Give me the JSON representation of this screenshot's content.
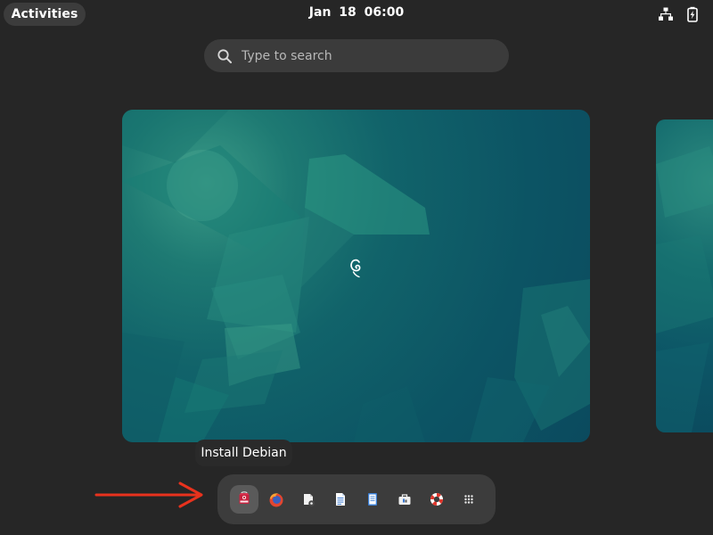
{
  "topbar": {
    "activities_label": "Activities",
    "clock": "Jan 18  06:00"
  },
  "search": {
    "placeholder": "Type to search"
  },
  "tooltip": {
    "label": "Install Debian"
  },
  "dash": {
    "apps": [
      {
        "name": "install-debian",
        "icon": "installer-icon",
        "active": true
      },
      {
        "name": "firefox",
        "icon": "firefox-icon"
      },
      {
        "name": "software",
        "icon": "software-icon"
      },
      {
        "name": "text-editor",
        "icon": "document-icon"
      },
      {
        "name": "text-editor-alt",
        "icon": "notes-icon"
      },
      {
        "name": "settings-tools",
        "icon": "toolbox-icon"
      },
      {
        "name": "help",
        "icon": "help-lifebuoy-icon"
      },
      {
        "name": "show-apps",
        "icon": "app-grid-icon"
      }
    ]
  },
  "colors": {
    "background": "#262626",
    "pill": "#3c3c3c",
    "annotation_arrow": "#e8321d",
    "wallpaper_teal": "#0c5464"
  }
}
